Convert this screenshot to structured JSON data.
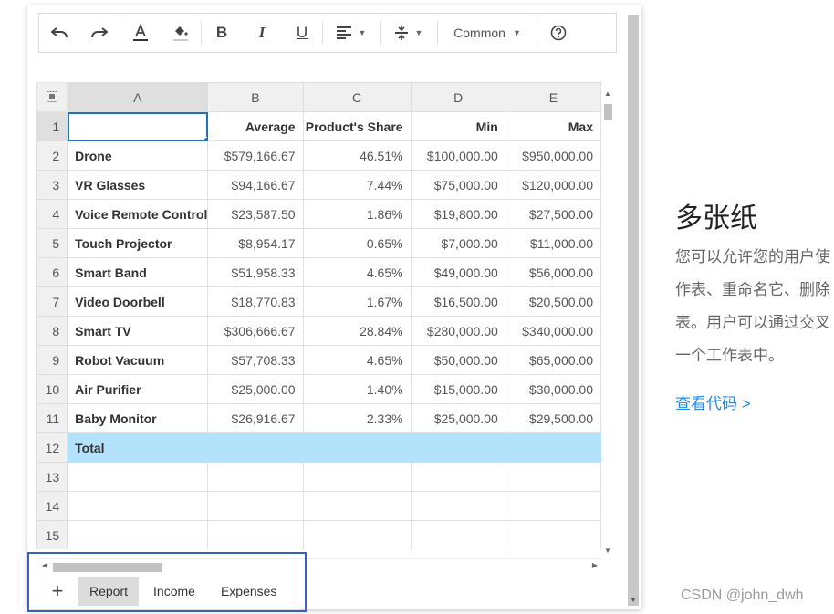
{
  "toolbar": {
    "font_style": "Common"
  },
  "columns": [
    "A",
    "B",
    "C",
    "D",
    "E"
  ],
  "header_row": {
    "row": "1",
    "cells": [
      "",
      "Average",
      "Product's Share",
      "Min",
      "Max"
    ]
  },
  "rows": [
    {
      "row": "2",
      "name": "Drone",
      "average": "$579,166.67",
      "share": "46.51%",
      "min": "$100,000.00",
      "max": "$950,000.00"
    },
    {
      "row": "3",
      "name": "VR Glasses",
      "average": "$94,166.67",
      "share": "7.44%",
      "min": "$75,000.00",
      "max": "$120,000.00"
    },
    {
      "row": "4",
      "name": "Voice Remote Control",
      "average": "$23,587.50",
      "share": "1.86%",
      "min": "$19,800.00",
      "max": "$27,500.00"
    },
    {
      "row": "5",
      "name": "Touch Projector",
      "average": "$8,954.17",
      "share": "0.65%",
      "min": "$7,000.00",
      "max": "$11,000.00"
    },
    {
      "row": "6",
      "name": "Smart Band",
      "average": "$51,958.33",
      "share": "4.65%",
      "min": "$49,000.00",
      "max": "$56,000.00"
    },
    {
      "row": "7",
      "name": "Video Doorbell",
      "average": "$18,770.83",
      "share": "1.67%",
      "min": "$16,500.00",
      "max": "$20,500.00"
    },
    {
      "row": "8",
      "name": "Smart TV",
      "average": "$306,666.67",
      "share": "28.84%",
      "min": "$280,000.00",
      "max": "$340,000.00"
    },
    {
      "row": "9",
      "name": "Robot Vacuum",
      "average": "$57,708.33",
      "share": "4.65%",
      "min": "$50,000.00",
      "max": "$65,000.00"
    },
    {
      "row": "10",
      "name": "Air Purifier",
      "average": "$25,000.00",
      "share": "1.40%",
      "min": "$15,000.00",
      "max": "$30,000.00"
    },
    {
      "row": "11",
      "name": "Baby Monitor",
      "average": "$26,916.67",
      "share": "2.33%",
      "min": "$25,000.00",
      "max": "$29,500.00"
    }
  ],
  "total_row": {
    "row": "12",
    "name": "Total"
  },
  "empty_rows": [
    "13",
    "14",
    "15"
  ],
  "sheets": {
    "add_label": "+",
    "tabs": [
      "Report",
      "Income",
      "Expenses"
    ],
    "active": "Report"
  },
  "side": {
    "title": "多张纸",
    "lines": [
      "您可以允许您的用户使",
      "作表、重命名它、删除",
      "表。用户可以通过交叉",
      "一个工作表中。"
    ],
    "link": "查看代码 >"
  },
  "watermark": "CSDN @john_dwh",
  "colors": {
    "accent": "#1e73be",
    "total_row": "#b3e3fa",
    "link": "#1e88e5",
    "highlight_box": "#3d5dc4"
  }
}
